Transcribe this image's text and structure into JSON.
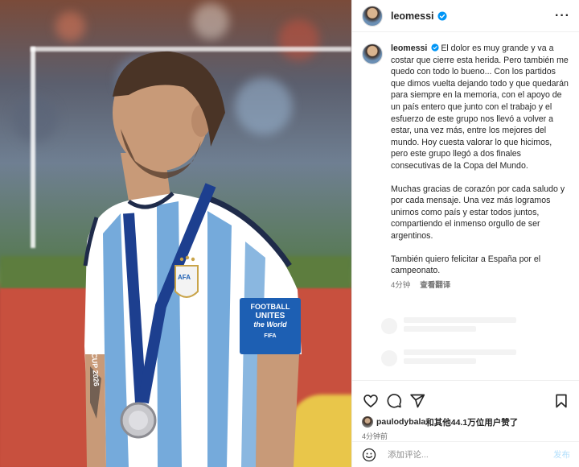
{
  "post": {
    "username": "leomessi",
    "caption_p1": "El dolor es muy grande y va a costar que cierre esta herida. Pero también me quedo con todo lo bueno... Con los partidos que dimos vuelta dejando todo y que quedarán para siempre en la memoria, con el apoyo de un país entero que junto con el trabajo y el esfuerzo de este grupo nos llevó a volver a estar, una vez más, entre los mejores del mundo. Hoy cuesta valorar lo que hicimos, pero este grupo llegó a dos finales consecutivas de la Copa del Mundo.",
    "caption_p2": "Muchas gracias de corazón por cada saludo y por cada mensaje. Una vez más logramos unirnos como país y estar todos juntos, compartiendo el inmenso orgullo de ser argentinos.",
    "caption_p3": "También quiero felicitar a España por el campeonato.",
    "caption_time": "4分钟",
    "translate_label": "查看翻译"
  },
  "photo": {
    "medal_text": "FIFA WORLD CUP 2026",
    "armband_line1": "FOOTBALL",
    "armband_line2": "UNITES",
    "armband_line3": "the World",
    "armband_brand": "FIFA",
    "crest_text": "AFA"
  },
  "likes": {
    "user": "paulodybala",
    "text": "和其他44.1万位用户赞了"
  },
  "post_time": "4分钟前",
  "comment": {
    "placeholder": "添加评论...",
    "post_label": "发布"
  },
  "icons": {
    "more": "more-icon",
    "verified": "verified-badge-icon",
    "like": "heart-icon",
    "comment": "comment-icon",
    "share": "share-icon",
    "save": "bookmark-icon",
    "emoji": "emoji-icon"
  },
  "colors": {
    "verified": "#0095f6",
    "jersey_blue": "#75aadb",
    "armband": "#1d5fb3",
    "post_button": "#b2dffc"
  }
}
